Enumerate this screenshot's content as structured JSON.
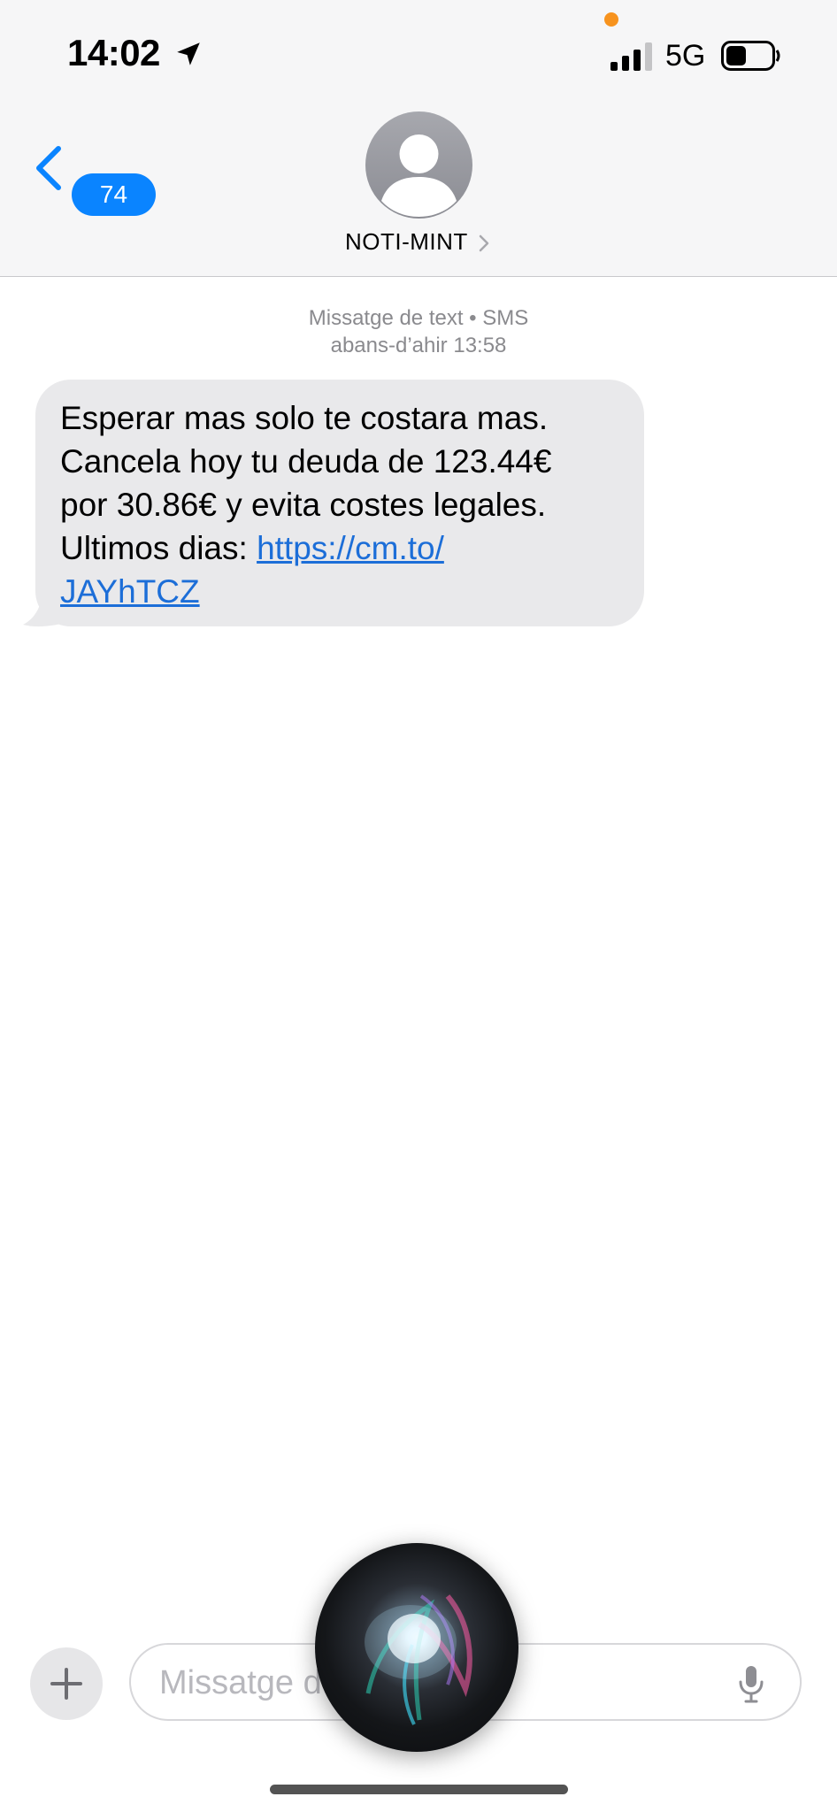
{
  "status_bar": {
    "time": "14:02",
    "network": "5G",
    "icons": [
      "location-arrow-icon",
      "signal-bars-icon",
      "battery-icon"
    ],
    "privacy_dot_color": "#f7931e"
  },
  "nav": {
    "back_badge": "74",
    "contact_name": "NOTI-MINT",
    "accent_color": "#0a84ff"
  },
  "thread": {
    "meta_line1": "Missatge de text • SMS",
    "meta_line2": "abans-d’ahir 13:58",
    "message": {
      "line1": "Esperar mas solo te costara mas.",
      "line2": "Cancela hoy tu deuda de 123.44€",
      "line3": "por 30.86€ y evita costes legales.",
      "line4_prefix": "Ultimos dias: ",
      "link_part1": "https://cm.to/",
      "link_part2": "JAYhTCZ"
    }
  },
  "composer": {
    "placeholder": "Missatge de text • SMS"
  }
}
